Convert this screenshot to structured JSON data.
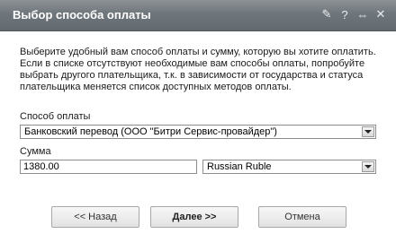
{
  "window": {
    "title": "Выбор способа оплаты"
  },
  "titlebar_icons": [
    "pin-icon",
    "help-icon",
    "restore-icon",
    "close-icon"
  ],
  "titlebar_icon_glyphs": {
    "pin": "✎",
    "help": "?",
    "restore": "⇔",
    "close": "✕"
  },
  "description": "Выберите удобный вам способ оплаты и сумму, которую вы хотите оплатить. Если в списке отсутствуют необходимые вам способы оплаты, попробуйте выбрать другого плательщика, т.к. в зависимости от государства и статуса плательщика меняется список доступных методов оплаты.",
  "payment_method": {
    "label": "Способ оплаты",
    "selected": "Банковский перевод (ООО \"Битри Сервис-провайдер\")"
  },
  "amount": {
    "label": "Сумма",
    "value": "1380.00",
    "currency": "Russian Ruble"
  },
  "buttons": {
    "back": "<< Назад",
    "next": "Далее >>",
    "cancel": "Отмена"
  }
}
